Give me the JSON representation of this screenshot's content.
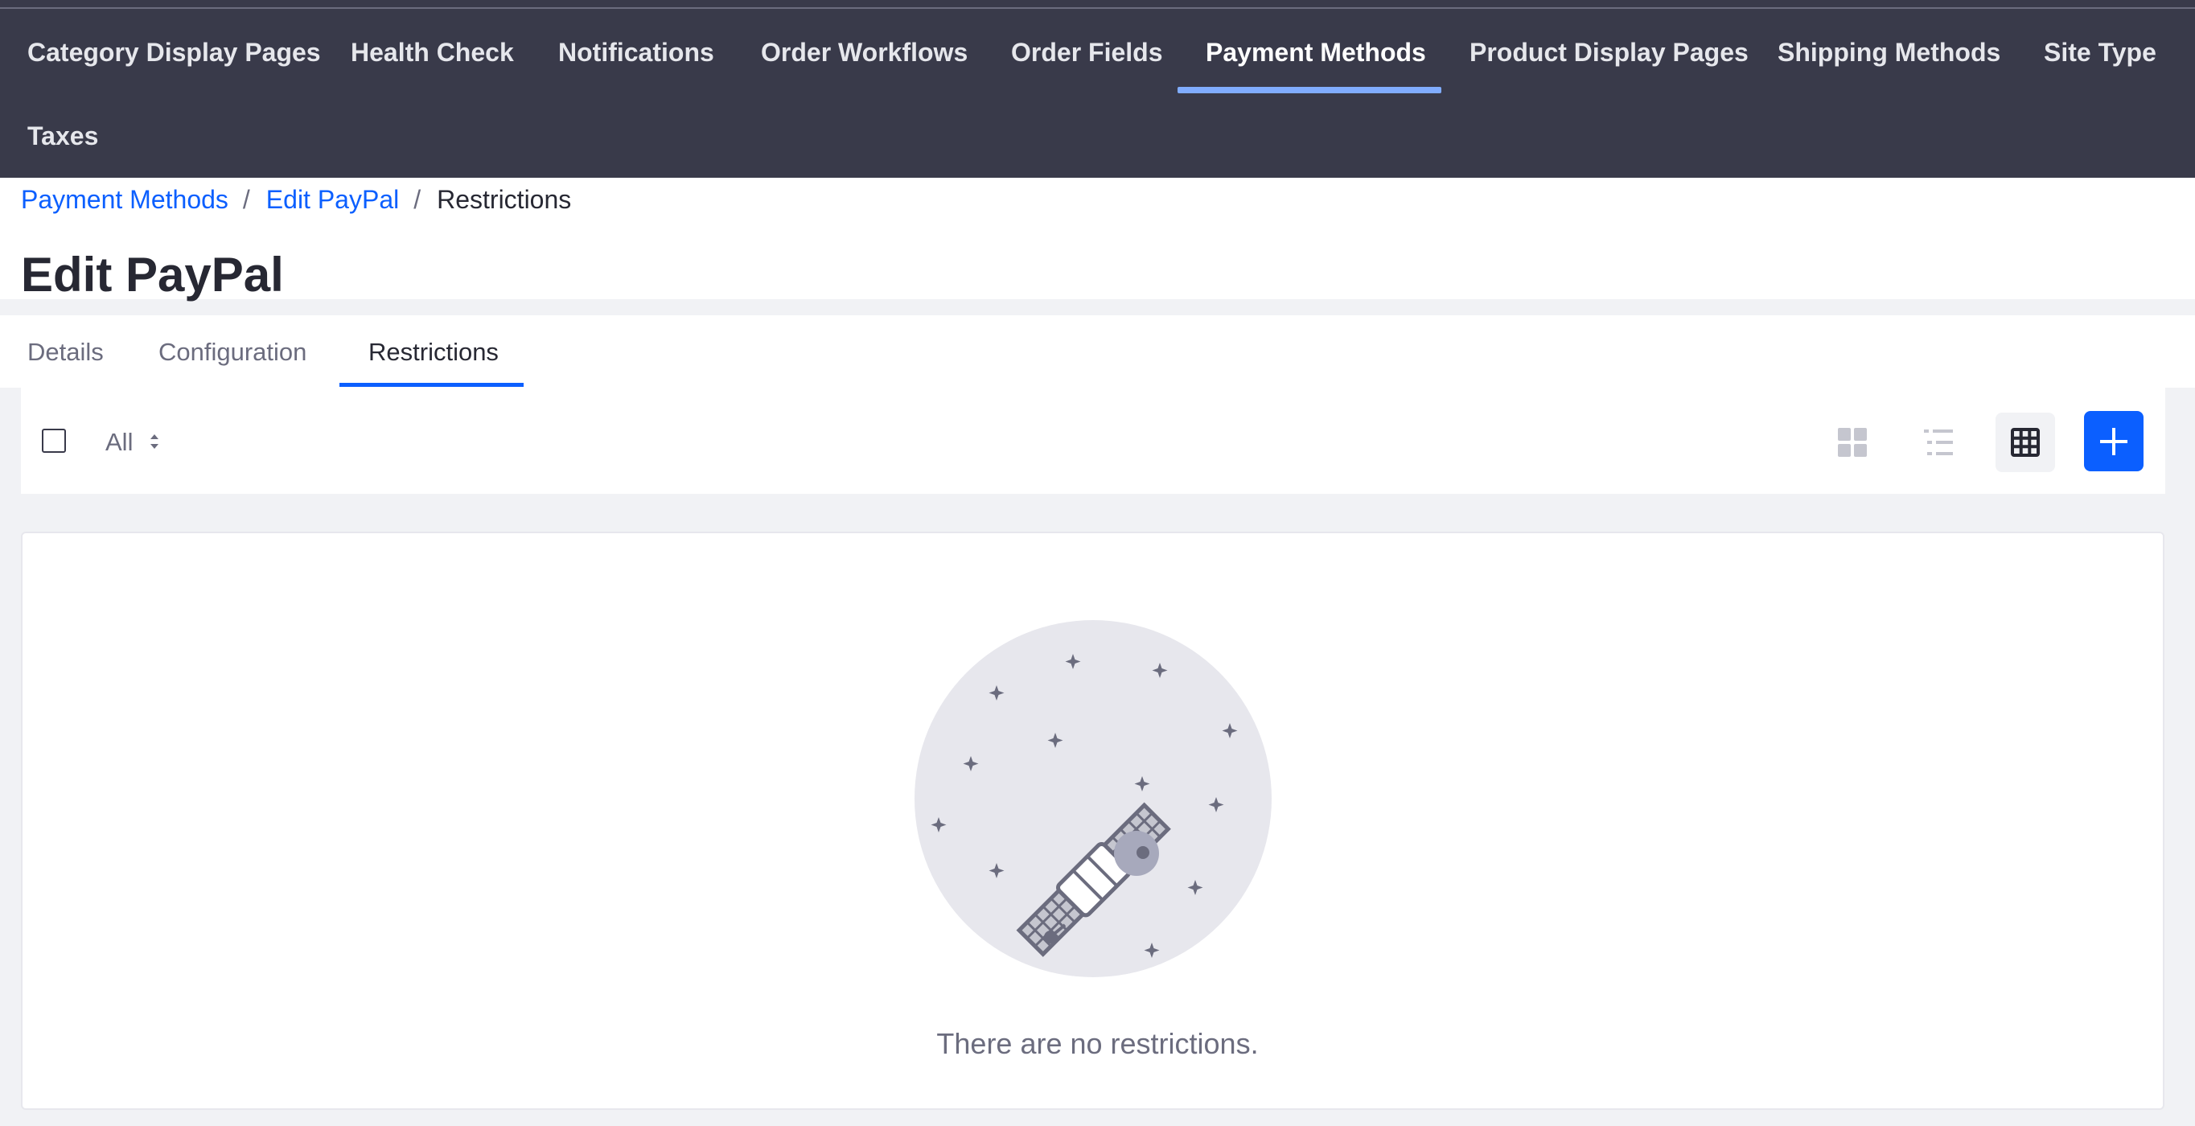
{
  "nav": {
    "items": [
      {
        "label": "Category Display Pages"
      },
      {
        "label": "Health Check"
      },
      {
        "label": "Notifications"
      },
      {
        "label": "Order Workflows"
      },
      {
        "label": "Order Fields"
      },
      {
        "label": "Payment Methods",
        "active": true
      },
      {
        "label": "Product Display Pages"
      },
      {
        "label": "Shipping Methods"
      },
      {
        "label": "Site Type"
      },
      {
        "label": "Taxes"
      }
    ]
  },
  "breadcrumb": {
    "items": [
      "Payment Methods",
      "Edit PayPal"
    ],
    "current": "Restrictions",
    "separator": "/"
  },
  "page": {
    "title": "Edit PayPal"
  },
  "tabs": [
    {
      "label": "Details"
    },
    {
      "label": "Configuration"
    },
    {
      "label": "Restrictions",
      "active": true
    }
  ],
  "toolbar": {
    "filter_label": "All",
    "views": [
      "cards-view-icon",
      "list-view-icon",
      "table-view-icon"
    ],
    "active_view": "table-view-icon",
    "add_icon": "plus-icon"
  },
  "empty_state": {
    "message": "There are no restrictions.",
    "illustration": "satellite-icon"
  },
  "colors": {
    "nav_bg": "#393a4a",
    "nav_active_underline": "#80acff",
    "primary": "#0b5fff",
    "page_bg": "#f1f2f5"
  }
}
